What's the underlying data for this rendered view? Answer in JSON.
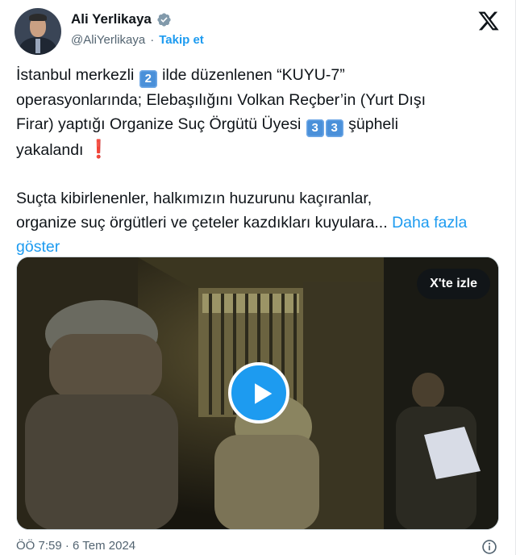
{
  "author": {
    "name": "Ali Yerlikaya",
    "handle": "@AliYerlikaya",
    "separator": "·",
    "follow_label": "Takip et"
  },
  "tweet": {
    "line1_a": "İstanbul merkezli ",
    "keycap_1": "2",
    "line1_b": " ilde düzenlenen  “KUYU-7”",
    "line2": "operasyonlarında; Elebaşılığını Volkan Reçber’in (Yurt Dışı",
    "line3_a": "Firar) yaptığı Organize Suç Örgütü Üyesi ",
    "keycap_2": "3",
    "keycap_3": "3",
    "line3_b": " şüpheli",
    "line4_a": "yakalandı ",
    "exclamation": "❗",
    "para2_line1": "Suçta kibirlenenler, halkımızın huzurunu kaçıranlar,",
    "para2_line2_a": "organize suç örgütleri ve çeteler kazdıkları kuyulara... ",
    "show_more": "Daha fazla göster"
  },
  "video": {
    "watch_label": "X'te izle"
  },
  "footer": {
    "timestamp": "ÖÖ 7:59 · 6 Tem 2024"
  },
  "colors": {
    "accent": "#1d9bf0",
    "text": "#0f1419",
    "muted": "#536471",
    "keycap": "#4a90d9"
  }
}
